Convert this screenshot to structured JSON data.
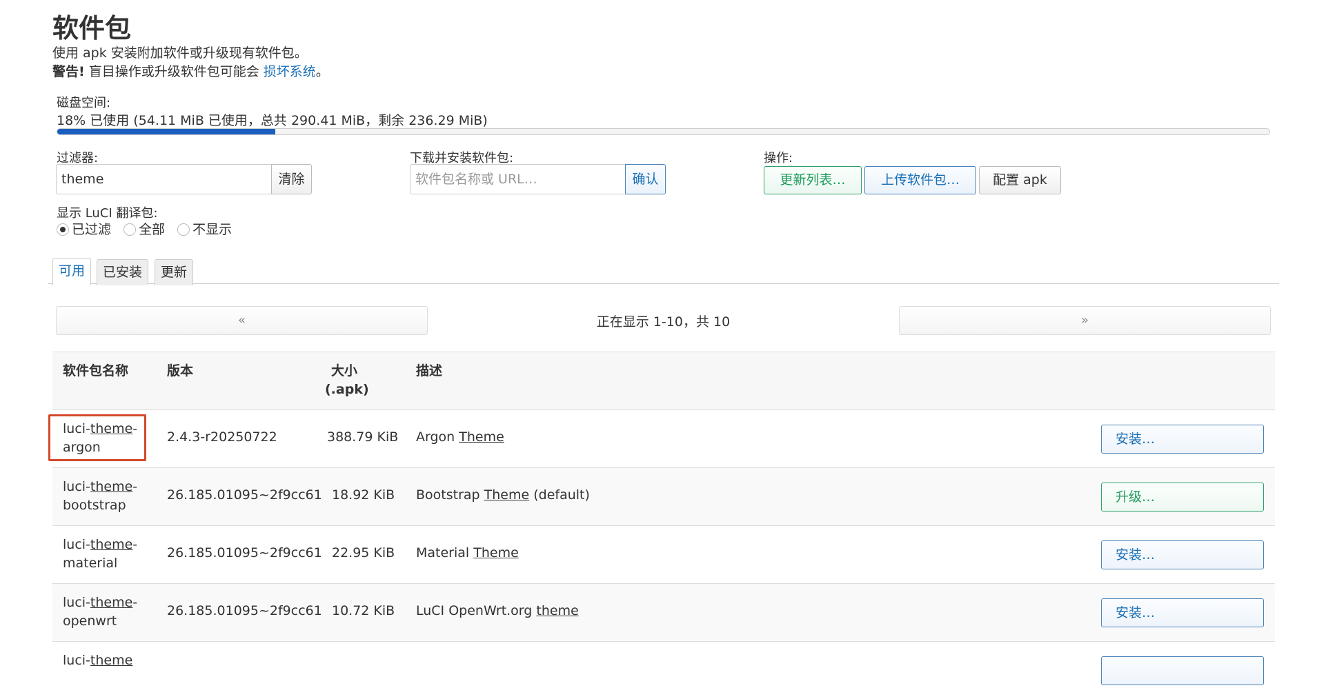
{
  "page": {
    "title": "软件包",
    "description": "使用 apk 安装附加软件或升级现有软件包。",
    "warning_bold": "警告!",
    "warning_text": " 盲目操作或升级软件包可能会 ",
    "warning_link": "损坏系统",
    "warning_end": "。"
  },
  "disk": {
    "label": "磁盘空间:",
    "usage_text": "18% 已使用 (54.11 MiB 已使用，总共 290.41 MiB，剩余 236.29 MiB)",
    "used_fraction": 0.18,
    "bar_color": "#1a5fbf"
  },
  "filter": {
    "label": "过滤器:",
    "value": "theme",
    "clear_label": "清除"
  },
  "download": {
    "label": "下载并安装软件包:",
    "placeholder": "软件包名称或 URL…",
    "confirm_label": "确认"
  },
  "actions": {
    "label": "操作:",
    "update_lists": "更新列表…",
    "upload_package": "上传软件包…",
    "configure": "配置 apk"
  },
  "translations": {
    "label": "显示 LuCI 翻译包:",
    "options": [
      "已过滤",
      "全部",
      "不显示"
    ],
    "selected": "已过滤"
  },
  "tabs": [
    {
      "label": "可用",
      "active": true
    },
    {
      "label": "已安装",
      "active": false
    },
    {
      "label": "更新",
      "active": false
    }
  ],
  "pager": {
    "prev": "«",
    "status": "正在显示 1-10，共 10",
    "next": "»"
  },
  "table": {
    "headers": {
      "name": "软件包名称",
      "version": "版本",
      "size_line1": "大小",
      "size_line2": "(.apk)",
      "description": "描述"
    },
    "rows": [
      {
        "name_pre": "luci-",
        "name_hl": "theme",
        "name_post": "-",
        "name_line2": "argon",
        "version": "2.4.3-r20250722",
        "size": "388.79 KiB",
        "desc_pre": "Argon ",
        "desc_hl": "Theme",
        "desc_post": "",
        "action": "安装…",
        "action_type": "install"
      },
      {
        "name_pre": "luci-",
        "name_hl": "theme",
        "name_post": "-",
        "name_line2": "bootstrap",
        "version": "26.185.01095~2f9cc61",
        "size": "18.92 KiB",
        "desc_pre": "Bootstrap ",
        "desc_hl": "Theme",
        "desc_post": " (default)",
        "action": "升级…",
        "action_type": "upgrade"
      },
      {
        "name_pre": "luci-",
        "name_hl": "theme",
        "name_post": "-",
        "name_line2": "material",
        "version": "26.185.01095~2f9cc61",
        "size": "22.95 KiB",
        "desc_pre": "Material ",
        "desc_hl": "Theme",
        "desc_post": "",
        "action": "安装…",
        "action_type": "install"
      },
      {
        "name_pre": "luci-",
        "name_hl": "theme",
        "name_post": "-",
        "name_line2": "openwrt",
        "version": "26.185.01095~2f9cc61",
        "size": "10.72 KiB",
        "desc_pre": "LuCI OpenWrt.org ",
        "desc_hl": "theme",
        "desc_post": "",
        "action": "安装…",
        "action_type": "install"
      },
      {
        "name_pre": "luci-",
        "name_hl": "theme",
        "name_post": "-",
        "name_line2": "",
        "version": "",
        "size": "",
        "desc_pre": "",
        "desc_hl": "",
        "desc_post": "",
        "action": "",
        "action_type": "install"
      }
    ]
  }
}
